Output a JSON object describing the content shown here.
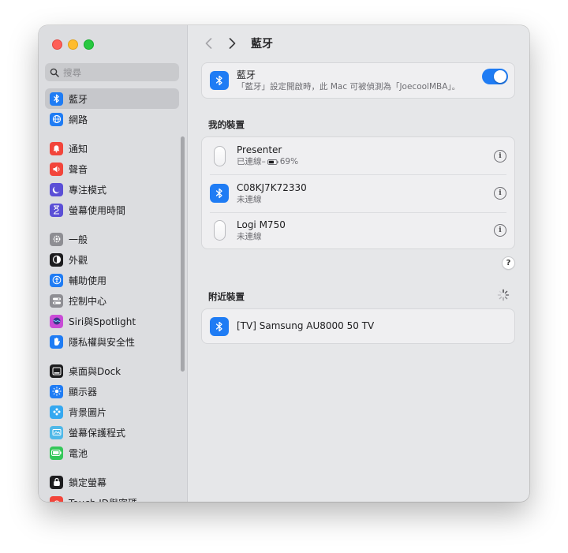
{
  "window": {
    "title": "藍牙"
  },
  "search": {
    "placeholder": "搜尋"
  },
  "sidebar": {
    "groups": [
      [
        {
          "label": "藍牙",
          "icon": "bluetooth-icon",
          "color": "#1f7cf4",
          "selected": true
        },
        {
          "label": "網路",
          "icon": "globe-icon",
          "color": "#1f7cf4"
        }
      ],
      [
        {
          "label": "通知",
          "icon": "bell-icon",
          "color": "#f2453b"
        },
        {
          "label": "聲音",
          "icon": "speaker-icon",
          "color": "#f2453b"
        },
        {
          "label": "專注模式",
          "icon": "moon-icon",
          "color": "#5b4fd6"
        },
        {
          "label": "螢幕使用時間",
          "icon": "hourglass-icon",
          "color": "#5b4fd6"
        }
      ],
      [
        {
          "label": "一般",
          "icon": "gear-icon",
          "color": "#8e8e93"
        },
        {
          "label": "外觀",
          "icon": "appearance-icon",
          "color": "#1d1d1f"
        },
        {
          "label": "輔助使用",
          "icon": "accessibility-icon",
          "color": "#1f7cf4"
        },
        {
          "label": "控制中心",
          "icon": "control-center-icon",
          "color": "#8e8e93"
        },
        {
          "label": "Siri與Spotlight",
          "icon": "siri-icon",
          "color": "#c94bd6"
        },
        {
          "label": "隱私權與安全性",
          "icon": "hand-icon",
          "color": "#1f7cf4"
        }
      ],
      [
        {
          "label": "桌面與Dock",
          "icon": "dock-icon",
          "color": "#1d1d1f"
        },
        {
          "label": "顯示器",
          "icon": "sun-icon",
          "color": "#1f7cf4"
        },
        {
          "label": "背景圖片",
          "icon": "wallpaper-icon",
          "color": "#35a8f0"
        },
        {
          "label": "螢幕保護程式",
          "icon": "screensaver-icon",
          "color": "#4fb8e8"
        },
        {
          "label": "電池",
          "icon": "battery-icon",
          "color": "#34c759"
        }
      ],
      [
        {
          "label": "鎖定螢幕",
          "icon": "lock-icon",
          "color": "#1d1d1f"
        },
        {
          "label": "Touch ID與密碼",
          "icon": "fingerprint-icon",
          "color": "#f2453b"
        }
      ]
    ]
  },
  "bluetooth": {
    "title": "藍牙",
    "description": "「藍牙」設定開啟時，此 Mac 可被偵測為「JoecoolMBA」。",
    "enabled": true
  },
  "my_devices": {
    "title": "我的裝置",
    "devices": [
      {
        "name": "Presenter",
        "status_prefix": "已連線–",
        "battery": "69%",
        "icon": "mouse-icon"
      },
      {
        "name": "C08KJ7K72330",
        "status": "未連線",
        "icon": "bluetooth-icon"
      },
      {
        "name": "Logi M750",
        "status": "未連線",
        "icon": "mouse-icon"
      }
    ]
  },
  "help": {
    "label": "?"
  },
  "nearby": {
    "title": "附近裝置",
    "devices": [
      {
        "name": "[TV] Samsung AU8000 50 TV",
        "icon": "bluetooth-icon"
      }
    ]
  },
  "colors": {
    "accent": "#1f7cf4"
  }
}
